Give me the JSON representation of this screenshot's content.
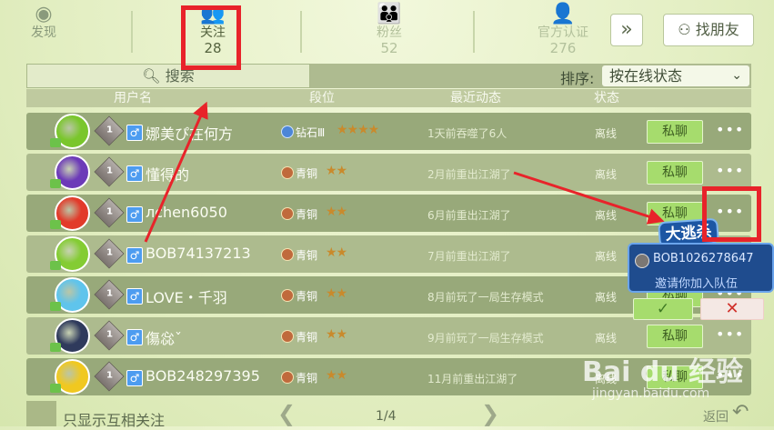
{
  "nav": {
    "discover": {
      "label": "发现"
    },
    "following": {
      "label": "关注",
      "count": "28"
    },
    "fans": {
      "label": "粉丝",
      "count": "52"
    },
    "official": {
      "label": "官方认证",
      "count": "276"
    },
    "more_label": "»",
    "find_friend_label": "找朋友"
  },
  "search": {
    "label": "搜索"
  },
  "sort": {
    "label": "排序:",
    "value": "按在线状态"
  },
  "table": {
    "headers": [
      "用户名",
      "段位",
      "最近动态",
      "状态"
    ],
    "chat_label": "私聊",
    "rows": [
      {
        "name": "娜美ぴ在何方",
        "tier": "钻石Ⅲ",
        "tier_type": "diamond",
        "stars": "★★★★",
        "recent": "1天前吞噬了6人",
        "status": "离线",
        "avatar_color": "#7ac62c"
      },
      {
        "name": "懂得的",
        "tier": "青铜",
        "tier_type": "bronze",
        "stars": "★★",
        "recent": "2月前重出江湖了",
        "status": "离线",
        "avatar_color": "#6c3ab8"
      },
      {
        "name": "лchen6050",
        "tier": "青铜",
        "tier_type": "bronze",
        "stars": "★★",
        "recent": "6月前重出江湖了",
        "status": "离线",
        "avatar_color": "#e23a2a"
      },
      {
        "name": "BOB74137213",
        "tier": "青铜",
        "tier_type": "bronze",
        "stars": "★★",
        "recent": "7月前重出江湖了",
        "status": "离线",
        "avatar_color": "#84cc33"
      },
      {
        "name": "LOVE・千羽",
        "tier": "青铜",
        "tier_type": "bronze",
        "stars": "★★",
        "recent": "8月前玩了一局生存模式",
        "status": "离线",
        "avatar_color": "#5fc4ec"
      },
      {
        "name": "傷惢ˇ",
        "tier": "青铜",
        "tier_type": "bronze",
        "stars": "★★",
        "recent": "9月前玩了一局生存模式",
        "status": "离线",
        "avatar_color": "#2f3a5c"
      },
      {
        "name": "BOB248297395",
        "tier": "青铜",
        "tier_type": "bronze",
        "stars": "★★",
        "recent": "11月前重出江湖了",
        "status": "离线",
        "avatar_color": "#f0c820"
      }
    ]
  },
  "footer": {
    "mutual_label": "只显示互相关注",
    "page": "1/4",
    "back_label": "返回"
  },
  "invite": {
    "tag": "大逃杀",
    "player": "BOB1026278647",
    "message": "邀请你加入队伍",
    "accept": "✓",
    "reject": "✕"
  },
  "watermark": {
    "brand": "Bai du 经验",
    "url": "jingyan.baidu.com"
  },
  "colors": {
    "row": "#98a97a",
    "row_alt": "#adbb8e",
    "accent": "#e8232a"
  }
}
